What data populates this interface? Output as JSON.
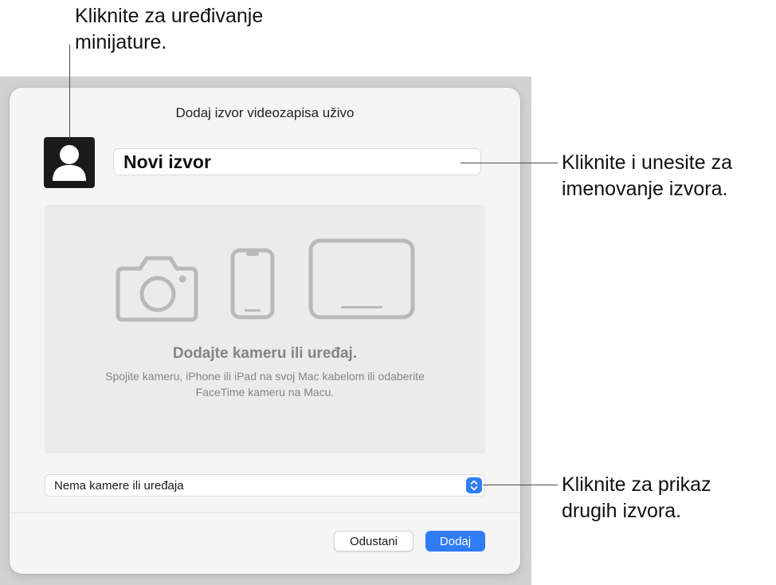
{
  "dialog": {
    "title": "Dodaj izvor videozapisa uživo",
    "thumbnail_icon": "person-silhouette-icon",
    "name_value": "Novi izvor",
    "drop_area": {
      "icons": [
        "camera-icon",
        "iphone-icon",
        "ipad-icon"
      ],
      "title": "Dodajte kameru ili uređaj.",
      "description": "Spojite kameru, iPhone ili iPad na svoj Mac kabelom ili odaberite FaceTime kameru na Macu."
    },
    "source_select": {
      "selected": "Nema kamere ili uređaja",
      "icon": "stepper-chevrons-icon"
    },
    "buttons": {
      "cancel": "Odustani",
      "add": "Dodaj"
    }
  },
  "callouts": {
    "thumbnail": "Kliknite za uređivanje minijature.",
    "name": "Kliknite i unesite za imenovanje izvora.",
    "source": "Kliknite za prikaz drugih izvora."
  },
  "colors": {
    "accent": "#2f7cf6",
    "dialog_bg": "#f5f5f5",
    "drop_area_bg": "#ebebeb",
    "muted_text": "#858585"
  }
}
